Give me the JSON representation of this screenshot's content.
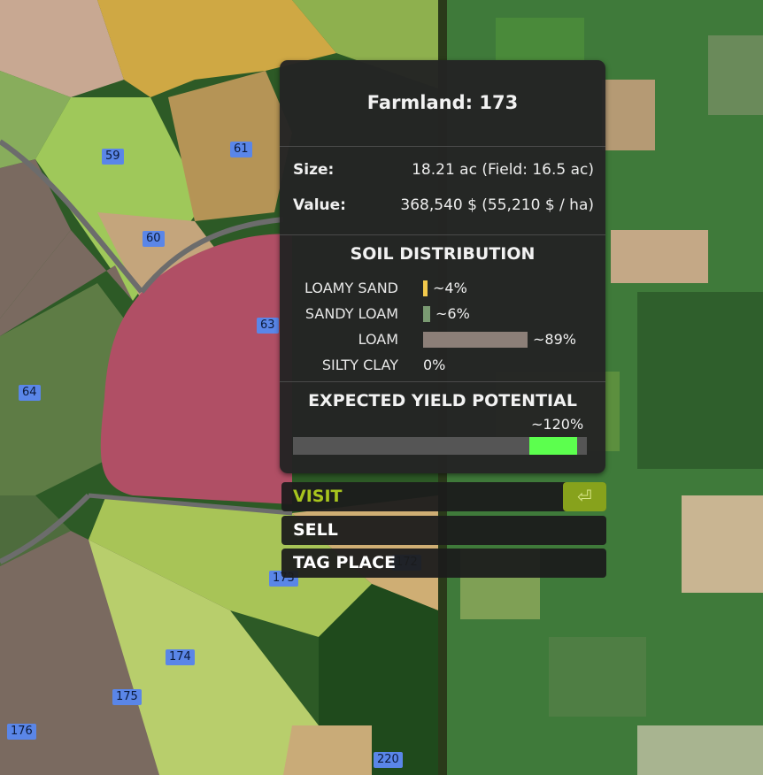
{
  "map": {
    "farmland_labels": [
      "59",
      "61",
      "60",
      "63",
      "64",
      "173",
      "172",
      "174",
      "175",
      "176",
      "220"
    ]
  },
  "info_panel": {
    "title": "Farmland: 173",
    "size_label": "Size:",
    "size_value": "18.21 ac (Field: 16.5 ac)",
    "value_label": "Value:",
    "value_value": "368,540 $ (55,210 $ / ha)",
    "soil_heading": "SOIL DISTRIBUTION",
    "soils": [
      {
        "name": "LOAMY SAND",
        "percent_text": "~4%",
        "fraction": 0.04,
        "color": "#f2c94c"
      },
      {
        "name": "SANDY LOAM",
        "percent_text": "~6%",
        "fraction": 0.06,
        "color": "#7a9a72"
      },
      {
        "name": "LOAM",
        "percent_text": "~89%",
        "fraction": 0.89,
        "color": "#8c7f78"
      },
      {
        "name": "SILTY CLAY",
        "percent_text": "0%",
        "fraction": 0.0,
        "color": "#9c7a6a"
      }
    ],
    "yield_heading": "EXPECTED YIELD POTENTIAL",
    "yield_text": "~120%",
    "yield_fraction": 1.2,
    "yield_fill_color": "#5cff4e"
  },
  "menu": {
    "items": [
      "VISIT",
      "SELL",
      "TAG PLACE"
    ],
    "active_index": 0,
    "enter_key_icon": "return-key-icon",
    "accent_color": "#a8c51e"
  }
}
